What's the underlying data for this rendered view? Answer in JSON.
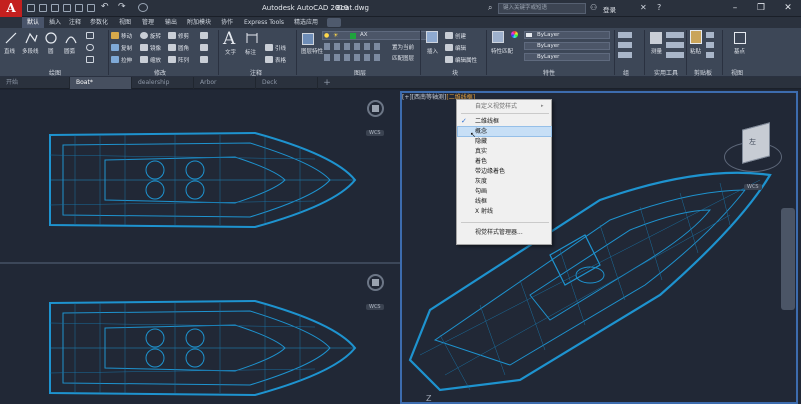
{
  "titlebar": {
    "app_title": "Autodesk AutoCAD 2019",
    "doc_name": "Boat.dwg",
    "search_placeholder": "键入关键字或短语",
    "login_label": "登录",
    "logo": "A"
  },
  "ribbon_tabs": [
    "默认",
    "插入",
    "注释",
    "参数化",
    "视图",
    "管理",
    "输出",
    "附加模块",
    "协作",
    "Express Tools",
    "精选应用"
  ],
  "ribbon": {
    "draw": {
      "line": "直线",
      "polyline": "多段线",
      "circle": "圆",
      "arc": "圆弧",
      "label": "绘图"
    },
    "modify": {
      "move": "移动",
      "rotate": "旋转",
      "trim": "修剪",
      "copy": "复制",
      "mirror": "镜像",
      "fillet": "圆角",
      "stretch": "拉伸",
      "scale": "缩放",
      "array": "阵列",
      "label": "修改"
    },
    "annotation": {
      "text": "文字",
      "dimension": "标注",
      "leader": "引线",
      "table": "表格",
      "label": "注释"
    },
    "layers": {
      "layer_props": "图层特性",
      "layer_name": "AX",
      "make_current": "置为当前",
      "match_layer": "匹配图层",
      "label": "图层"
    },
    "block": {
      "insert": "插入",
      "create": "创建",
      "edit": "编辑",
      "edit_attr": "编辑属性",
      "label": "块"
    },
    "properties": {
      "match_props": "特性匹配",
      "bylayer_1": "ByLayer",
      "bylayer_2": "ByLayer",
      "bylayer_3": "ByLayer",
      "label": "特性"
    },
    "groups": {
      "label": "组"
    },
    "utilities": {
      "measure": "测量",
      "label": "实用工具"
    },
    "clipboard": {
      "paste": "粘贴",
      "label": "剪贴板"
    },
    "view": {
      "base": "基点",
      "label": "视图"
    }
  },
  "file_tabs": [
    "开始",
    "Boat*",
    "dealership",
    "Arbor",
    "Deck"
  ],
  "viewport_label": {
    "prefix": "[+][西南等轴测]",
    "style": "[二维线框]"
  },
  "wcs_labels": [
    "WCS",
    "WCS",
    "WCS"
  ],
  "viewcube_label": "左",
  "context_menu": {
    "header": "自定义视觉样式",
    "items": [
      "二维线框",
      "概念",
      "隐藏",
      "真实",
      "着色",
      "带边缘着色",
      "灰度",
      "勾画",
      "线框",
      "X 射线"
    ],
    "checked_index": 0,
    "highlighted_index": 1,
    "footer": "视觉样式管理器..."
  },
  "colors": {
    "hull": "#1e93cf",
    "accent": "#3d6cae",
    "logo_red": "#c4201f",
    "highlight": "#c7dff6"
  }
}
